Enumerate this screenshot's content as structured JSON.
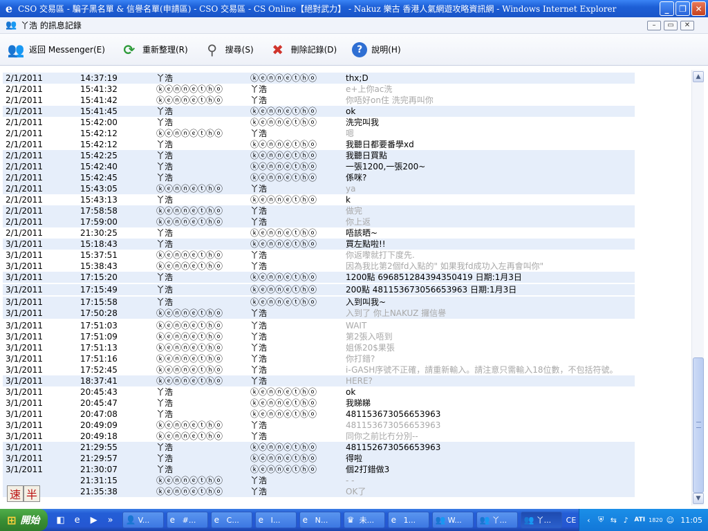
{
  "window": {
    "title": "CSO 交易區 - 騙子黑名單 & 信譽名單(申請區) - CSO 交易區 - CS Online【絕對武力】 - Nakuz 樂古 香港人氣網遊攻略資訊網 - Windows Internet Explorer"
  },
  "dialog": {
    "title": "丫浩 的訊息記錄"
  },
  "toolbar": {
    "back_label": "返回 Messenger(E)",
    "refresh_label": "重新整理(R)",
    "search_label": "搜尋(S)",
    "delete_label": "刪除記錄(D)",
    "help_label": "說明(H)"
  },
  "log": {
    "rows": [
      {
        "date": "2/1/2011",
        "time": "14:37:19",
        "from": "丫浩",
        "to": "ⓚⓔⓝⓝⓔⓣⓗⓞ",
        "msg": "thx;D"
      },
      {
        "date": "2/1/2011",
        "time": "15:41:32",
        "from": "ⓚⓔⓝⓝⓔⓣⓗⓞ",
        "to": "丫浩",
        "msg": "e+上你ac洗"
      },
      {
        "date": "2/1/2011",
        "time": "15:41:42",
        "from": "ⓚⓔⓝⓝⓔⓣⓗⓞ",
        "to": "丫浩",
        "msg": "你唔好on住 洗完再叫你"
      },
      {
        "date": "2/1/2011",
        "time": "15:41:45",
        "from": "丫浩",
        "to": "ⓚⓔⓝⓝⓔⓣⓗⓞ",
        "msg": "ok"
      },
      {
        "date": "2/1/2011",
        "time": "15:42:00",
        "from": "丫浩",
        "to": "ⓚⓔⓝⓝⓔⓣⓗⓞ",
        "msg": "洗完叫我"
      },
      {
        "date": "2/1/2011",
        "time": "15:42:12",
        "from": "ⓚⓔⓝⓝⓔⓣⓗⓞ",
        "to": "丫浩",
        "msg": "嗯"
      },
      {
        "date": "2/1/2011",
        "time": "15:42:12",
        "from": "丫浩",
        "to": "ⓚⓔⓝⓝⓔⓣⓗⓞ",
        "msg": "我聽日都要番學xd"
      },
      {
        "date": "2/1/2011",
        "time": "15:42:25",
        "from": "丫浩",
        "to": "ⓚⓔⓝⓝⓔⓣⓗⓞ",
        "msg": "我聽日買點"
      },
      {
        "date": "2/1/2011",
        "time": "15:42:40",
        "from": "丫浩",
        "to": "ⓚⓔⓝⓝⓔⓣⓗⓞ",
        "msg": "一張1200,一張200~"
      },
      {
        "date": "2/1/2011",
        "time": "15:42:45",
        "from": "丫浩",
        "to": "ⓚⓔⓝⓝⓔⓣⓗⓞ",
        "msg": "係咪?"
      },
      {
        "date": "2/1/2011",
        "time": "15:43:05",
        "from": "ⓚⓔⓝⓝⓔⓣⓗⓞ",
        "to": "丫浩",
        "msg": "ya"
      },
      {
        "date": "2/1/2011",
        "time": "15:43:13",
        "from": "丫浩",
        "to": "ⓚⓔⓝⓝⓔⓣⓗⓞ",
        "msg": "k"
      },
      {
        "date": "2/1/2011",
        "time": "17:58:58",
        "from": "ⓚⓔⓝⓝⓔⓣⓗⓞ",
        "to": "丫浩",
        "msg": "做完"
      },
      {
        "date": "2/1/2011",
        "time": "17:59:00",
        "from": "ⓚⓔⓝⓝⓔⓣⓗⓞ",
        "to": "丫浩",
        "msg": "你上返"
      },
      {
        "date": "2/1/2011",
        "time": "21:30:25",
        "from": "丫浩",
        "to": "ⓚⓔⓝⓝⓔⓣⓗⓞ",
        "msg": "唔該晒~"
      },
      {
        "date": "3/1/2011",
        "time": "15:18:43",
        "from": "丫浩",
        "to": "ⓚⓔⓝⓝⓔⓣⓗⓞ",
        "msg": "買左點啦!!"
      },
      {
        "date": "3/1/2011",
        "time": "15:37:51",
        "from": "ⓚⓔⓝⓝⓔⓣⓗⓞ",
        "to": "丫浩",
        "msg": "你返嚟就打下度先."
      },
      {
        "date": "3/1/2011",
        "time": "15:38:43",
        "from": "ⓚⓔⓝⓝⓔⓣⓗⓞ",
        "to": "丫浩",
        "msg": "因為我比第2個fd入點的\" 如果我fd成功入左再會叫你\""
      },
      {
        "date": "3/1/2011",
        "time": "17:15:20",
        "from": "丫浩",
        "to": "ⓚⓔⓝⓝⓔⓣⓗⓞ",
        "msg": "1200點 696851284394350419 日期:1月3日"
      },
      {
        "date": "3/1/2011",
        "time": "17:15:49",
        "from": "丫浩",
        "to": "ⓚⓔⓝⓝⓔⓣⓗⓞ",
        "msg": "200點 481153673056653963 日期:1月3日"
      },
      {
        "date": "3/1/2011",
        "time": "17:15:58",
        "from": "丫浩",
        "to": "ⓚⓔⓝⓝⓔⓣⓗⓞ",
        "msg": "入到叫我~"
      },
      {
        "date": "3/1/2011",
        "time": "17:50:28",
        "from": "ⓚⓔⓝⓝⓔⓣⓗⓞ",
        "to": "丫浩",
        "msg": "入到了 你上NAKUZ 攞信譽"
      },
      {
        "date": "3/1/2011",
        "time": "17:51:03",
        "from": "ⓚⓔⓝⓝⓔⓣⓗⓞ",
        "to": "丫浩",
        "msg": "WAIT"
      },
      {
        "date": "3/1/2011",
        "time": "17:51:09",
        "from": "ⓚⓔⓝⓝⓔⓣⓗⓞ",
        "to": "丫浩",
        "msg": "第2張入唔到"
      },
      {
        "date": "3/1/2011",
        "time": "17:51:13",
        "from": "ⓚⓔⓝⓝⓔⓣⓗⓞ",
        "to": "丫浩",
        "msg": "姐係20$果張"
      },
      {
        "date": "3/1/2011",
        "time": "17:51:16",
        "from": "ⓚⓔⓝⓝⓔⓣⓗⓞ",
        "to": "丫浩",
        "msg": "你打錯?"
      },
      {
        "date": "3/1/2011",
        "time": "17:52:45",
        "from": "ⓚⓔⓝⓝⓔⓣⓗⓞ",
        "to": "丫浩",
        "msg": "i-GASH序號不正確，請重新輸入。請注意只需輸入18位數，不包括符號。"
      },
      {
        "date": "3/1/2011",
        "time": "18:37:41",
        "from": "ⓚⓔⓝⓝⓔⓣⓗⓞ",
        "to": "丫浩",
        "msg": "HERE?"
      },
      {
        "date": "3/1/2011",
        "time": "20:45:43",
        "from": "丫浩",
        "to": "ⓚⓔⓝⓝⓔⓣⓗⓞ",
        "msg": "ok"
      },
      {
        "date": "3/1/2011",
        "time": "20:45:47",
        "from": "丫浩",
        "to": "ⓚⓔⓝⓝⓔⓣⓗⓞ",
        "msg": "我睇睇"
      },
      {
        "date": "3/1/2011",
        "time": "20:47:08",
        "from": "丫浩",
        "to": "ⓚⓔⓝⓝⓔⓣⓗⓞ",
        "msg": "481153673056653963"
      },
      {
        "date": "3/1/2011",
        "time": "20:49:09",
        "from": "ⓚⓔⓝⓝⓔⓣⓗⓞ",
        "to": "丫浩",
        "msg": "481153673056653963"
      },
      {
        "date": "3/1/2011",
        "time": "20:49:18",
        "from": "ⓚⓔⓝⓝⓔⓣⓗⓞ",
        "to": "丫浩",
        "msg": "同你之前比冇分別--"
      },
      {
        "date": "3/1/2011",
        "time": "21:29:55",
        "from": "丫浩",
        "to": "ⓚⓔⓝⓝⓔⓣⓗⓞ",
        "msg": "481152673056653963"
      },
      {
        "date": "3/1/2011",
        "time": "21:29:57",
        "from": "丫浩",
        "to": "ⓚⓔⓝⓝⓔⓣⓗⓞ",
        "msg": "得啦"
      },
      {
        "date": "3/1/2011",
        "time": "21:30:07",
        "from": "丫浩",
        "to": "ⓚⓔⓝⓝⓔⓣⓗⓞ",
        "msg": "個2打錯做3"
      },
      {
        "date": "",
        "time": "21:31:15",
        "from": "ⓚⓔⓝⓝⓔⓣⓗⓞ",
        "to": "丫浩",
        "msg": "- -"
      },
      {
        "date": "",
        "time": "21:35:38",
        "from": "ⓚⓔⓝⓝⓔⓣⓗⓞ",
        "to": "丫浩",
        "msg": "OK了"
      }
    ]
  },
  "ime": {
    "speed_label": "速",
    "half_label": "半"
  },
  "taskbar": {
    "start_label": "開始",
    "items": [
      {
        "icon": "user-icon",
        "label": "V..."
      },
      {
        "icon": "ie-icon",
        "label": "#..."
      },
      {
        "icon": "ie-icon",
        "label": "C..."
      },
      {
        "icon": "ie-icon",
        "label": "I..."
      },
      {
        "icon": "ie-icon",
        "label": "N..."
      },
      {
        "icon": "game-icon",
        "label": "未..."
      },
      {
        "icon": "ie-icon",
        "label": "1..."
      },
      {
        "icon": "messenger-icon",
        "label": "W..."
      },
      {
        "icon": "messenger-icon",
        "label": "丫..."
      },
      {
        "icon": "messenger-icon",
        "label": "丫..."
      }
    ],
    "lang_label": "CE",
    "tray_extra": "1820",
    "clock": "11:05"
  }
}
